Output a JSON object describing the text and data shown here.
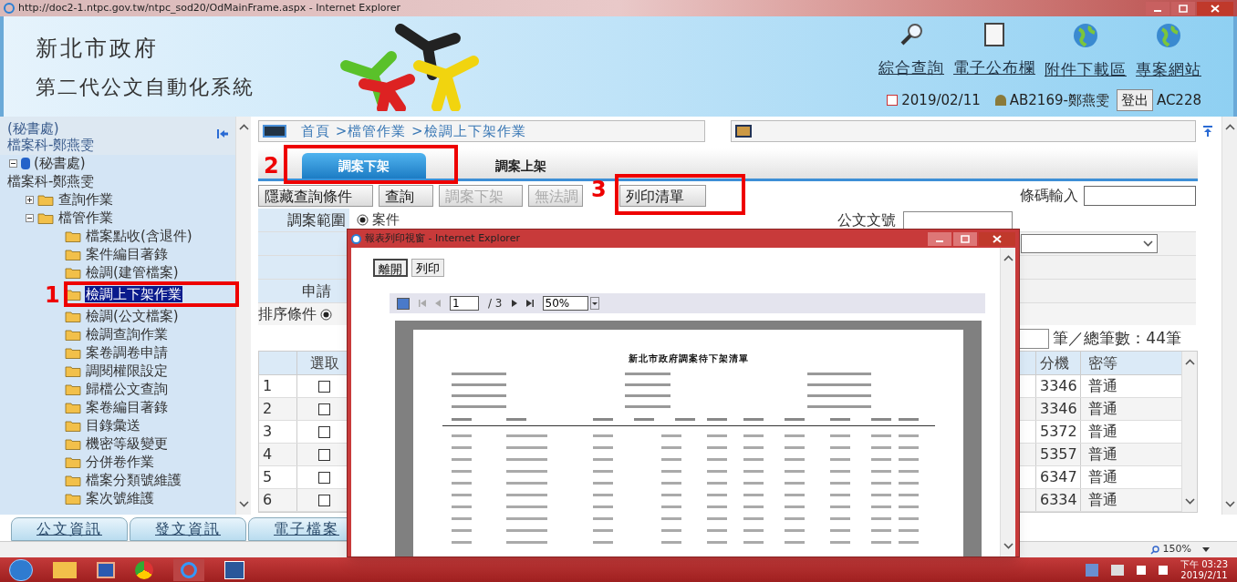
{
  "browser": {
    "title": "http://doc2-1.ntpc.gov.tw/ntpc_sod20/OdMainFrame.aspx - Internet Explorer",
    "zoom": "150%"
  },
  "header": {
    "org": "新北市政府",
    "system": "第二代公文自動化系統",
    "nav": [
      {
        "label": "綜合查詢",
        "kind": "search"
      },
      {
        "label": "電子公布欄",
        "kind": "board"
      },
      {
        "label": "附件下載區",
        "kind": "globe"
      },
      {
        "label": "專案網站",
        "kind": "globe"
      }
    ],
    "date": "2019/02/11",
    "user": "AB2169-鄭燕雯",
    "logout": "登出",
    "code": "AC228"
  },
  "sidebar": {
    "unit": "(秘書處)",
    "user": "檔案科-鄭燕雯",
    "tree": {
      "label": "(秘書處)",
      "sublabel": "檔案科-鄭燕雯",
      "expanded": true,
      "children": [
        {
          "label": "查詢作業",
          "expanded": false,
          "selected": false
        },
        {
          "label": "檔管作業",
          "expanded": true,
          "selected": false,
          "children": [
            {
              "label": "檔案點收(含退件)",
              "selected": false
            },
            {
              "label": "案件編目著錄",
              "selected": false
            },
            {
              "label": "檢調(建管檔案)",
              "selected": false
            },
            {
              "label": "檢調上下架作業",
              "selected": true
            },
            {
              "label": "檢調(公文檔案)",
              "selected": false
            },
            {
              "label": "檢調查詢作業",
              "selected": false
            },
            {
              "label": "案卷調卷申請",
              "selected": false
            },
            {
              "label": "調閱權限設定",
              "selected": false
            },
            {
              "label": "歸檔公文查詢",
              "selected": false
            },
            {
              "label": "案卷編目著錄",
              "selected": false
            },
            {
              "label": "目錄彙送",
              "selected": false
            },
            {
              "label": "機密等級變更",
              "selected": false
            },
            {
              "label": "分併卷作業",
              "selected": false
            },
            {
              "label": "檔案分類號維護",
              "selected": false
            },
            {
              "label": "案次號維護",
              "selected": false
            }
          ]
        }
      ]
    },
    "bottom_tabs": [
      "公文資訊",
      "發文資訊",
      "電子檔案"
    ]
  },
  "breadcrumb": "首頁 >檔管作業 >檢調上下架作業",
  "tabs": [
    {
      "label": "調案下架",
      "selected": true
    },
    {
      "label": "調案上架",
      "selected": false
    }
  ],
  "toolbar": [
    {
      "label": "隱藏查詢條件",
      "disabled": false
    },
    {
      "label": "查詢",
      "disabled": false
    },
    {
      "label": "調案下架",
      "disabled": true
    },
    {
      "label": "無法調",
      "disabled": true
    },
    {
      "label": "列印清單",
      "disabled": false
    }
  ],
  "barcode": {
    "label": "條碼輸入"
  },
  "form": {
    "scope_label": "調案範圍",
    "scope_option": "案件",
    "scope_selected": true,
    "doc_no_label": "公文文號",
    "apply_label": "申請"
  },
  "sort": {
    "label": "排序條件",
    "selected": true
  },
  "pager": {
    "text": "筆／總筆數：44筆"
  },
  "table": {
    "columns": [
      "選取",
      "分機",
      "密等"
    ],
    "rows": [
      {
        "index": "1",
        "checked": false,
        "ext": "3346",
        "class": "普通"
      },
      {
        "index": "2",
        "checked": false,
        "ext": "3346",
        "class": "普通"
      },
      {
        "index": "3",
        "checked": false,
        "ext": "5372",
        "class": "普通"
      },
      {
        "index": "4",
        "checked": false,
        "ext": "5357",
        "class": "普通"
      },
      {
        "index": "5",
        "checked": false,
        "ext": "6347",
        "class": "普通"
      },
      {
        "index": "6",
        "checked": false,
        "ext": "6334",
        "class": "普通"
      }
    ]
  },
  "popup": {
    "title": "報表列印視窗 - Internet Explorer",
    "buttons": [
      "離開",
      "列印"
    ],
    "page": "1",
    "pages": "/ 3",
    "zoom": "50%",
    "report_title": "新北市政府調案待下架清單"
  },
  "annotations": [
    {
      "number": "1"
    },
    {
      "number": "2"
    },
    {
      "number": "3"
    }
  ],
  "taskbar": {
    "time": "下午 03:23",
    "date": "2019/2/11"
  }
}
